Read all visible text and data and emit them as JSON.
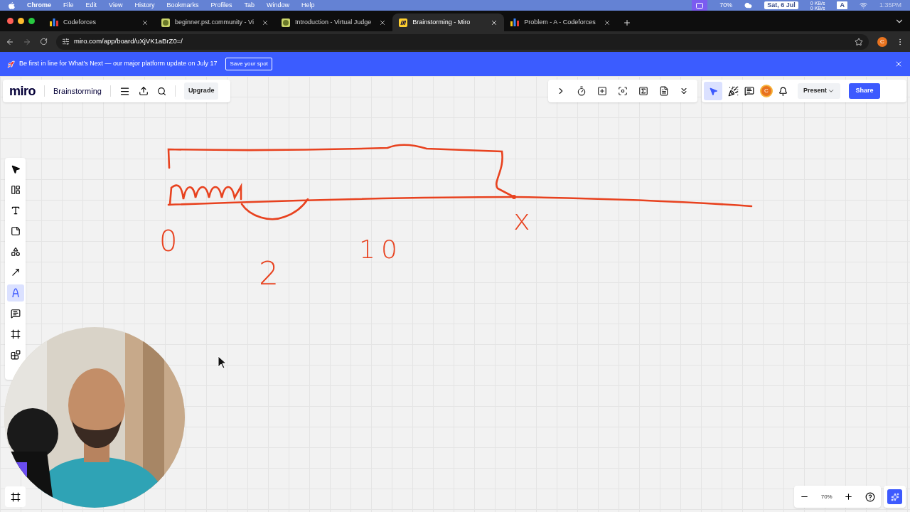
{
  "menubar": {
    "app": "Chrome",
    "items": [
      "File",
      "Edit",
      "View",
      "History",
      "Bookmarks",
      "Profiles",
      "Tab",
      "Window",
      "Help"
    ],
    "battery": "70%",
    "date": "Sat, 6 Jul",
    "net_up": "0 KB/s",
    "net_down": "0 KB/s",
    "input_source": "A",
    "time": "1:35PM"
  },
  "tabs": [
    {
      "title": "Codeforces",
      "kind": "bars",
      "selected": false
    },
    {
      "title": "beginner.pst.community - Vi",
      "kind": "judge",
      "selected": false
    },
    {
      "title": "Introduction - Virtual Judge",
      "kind": "judge",
      "selected": false
    },
    {
      "title": "Brainstorming - Miro",
      "kind": "miro",
      "selected": true
    },
    {
      "title": "Problem - A - Codeforces",
      "kind": "bars",
      "selected": false
    }
  ],
  "address_bar": {
    "url": "miro.com/app/board/uXjVK1aBrZ0=/",
    "profile": "C"
  },
  "banner": {
    "text": "Be first in line for What’s Next — our major platform update on July 17",
    "button": "Save your spot"
  },
  "board_bar": {
    "logo": "miro",
    "title": "Brainstorming",
    "upgrade": "Upgrade"
  },
  "top_tools": [
    {
      "kind": "chevron"
    },
    {
      "kind": "timer"
    },
    {
      "kind": "card"
    },
    {
      "kind": "focus"
    },
    {
      "kind": "counter"
    },
    {
      "kind": "notes"
    },
    {
      "kind": "more"
    }
  ],
  "collab": {
    "cursor_selected": true,
    "avatar": "C",
    "present": "Present",
    "share": "Share"
  },
  "tools": [
    {
      "kind": "select",
      "selected": false
    },
    {
      "kind": "templates",
      "selected": false
    },
    {
      "kind": "text",
      "selected": false
    },
    {
      "kind": "sticky",
      "selected": false
    },
    {
      "kind": "shapes",
      "selected": false
    },
    {
      "kind": "arrow",
      "selected": false
    },
    {
      "kind": "pen",
      "selected": true
    },
    {
      "kind": "comment",
      "selected": false
    },
    {
      "kind": "frame",
      "selected": false
    },
    {
      "kind": "apps",
      "selected": false
    }
  ],
  "sketch_labels": [
    "0",
    "2",
    "10",
    "x"
  ],
  "zoom": {
    "level": "70%"
  }
}
